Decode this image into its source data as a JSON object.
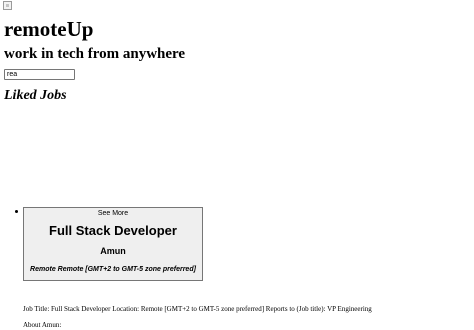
{
  "header": {
    "title": "remoteUp",
    "subtitle": "work in tech from anywhere"
  },
  "search": {
    "value": "rea"
  },
  "section": {
    "title": "Liked Jobs"
  },
  "jobs": [
    {
      "see_more_label": "See More",
      "title": "Full Stack Developer",
      "company": "Amun",
      "location": "Remote Remote [GMT+2 to GMT-5 zone preferred]",
      "description": "Job Title: Full Stack Developer Location: Remote [GMT+2 to GMT-5 zone preferred] Reports to (Job title): VP Engineering",
      "about": "About Amun:"
    }
  ],
  "icons": {
    "logo": "broken-image-icon"
  }
}
